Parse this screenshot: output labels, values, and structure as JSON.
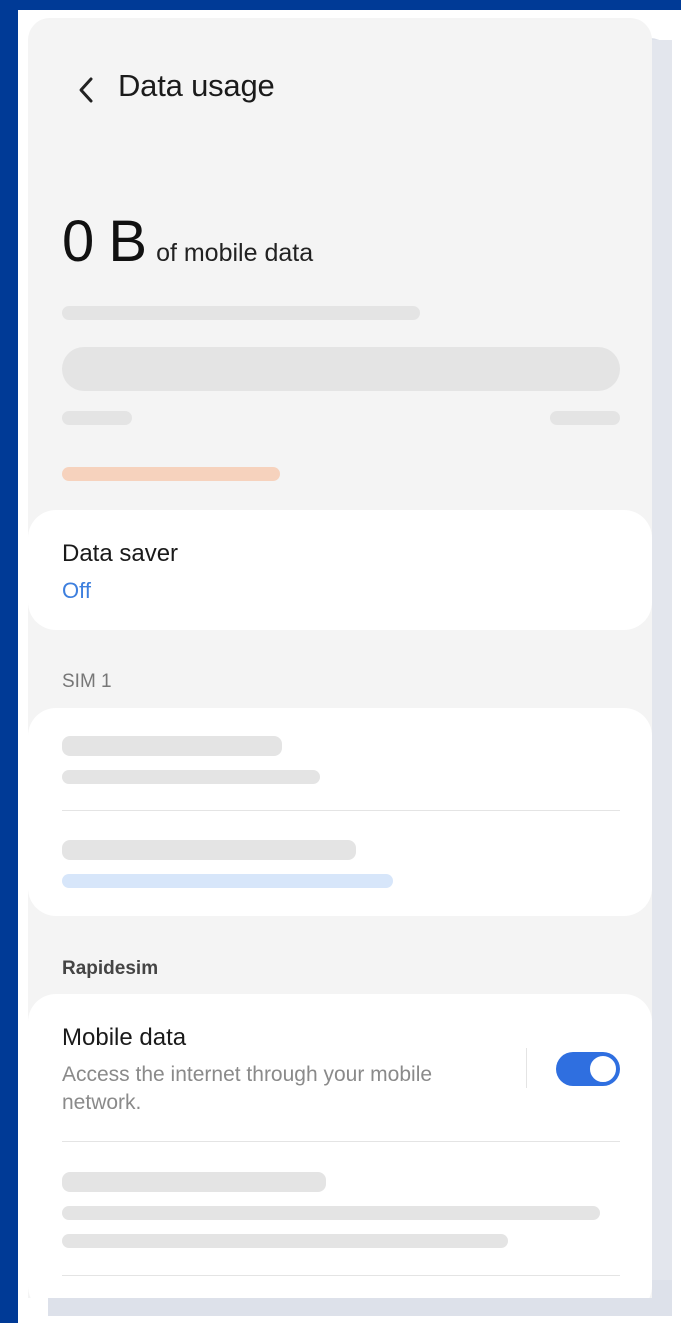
{
  "header": {
    "back_icon": "chevron-left-icon",
    "title": "Data usage"
  },
  "usage": {
    "value": "0 B",
    "suffix": "of mobile data"
  },
  "data_saver": {
    "title": "Data saver",
    "status": "Off"
  },
  "sections": {
    "sim_label": "SIM 1",
    "carrier_label": "Rapidesim"
  },
  "mobile_data": {
    "title": "Mobile data",
    "description": "Access the internet through your mobile network.",
    "enabled": true
  },
  "colors": {
    "background": "#003a96",
    "accent": "#2f6fe0",
    "link": "#3d7fde",
    "warning_bar": "#f6d2bd",
    "info_bar": "#d7e6fa"
  }
}
